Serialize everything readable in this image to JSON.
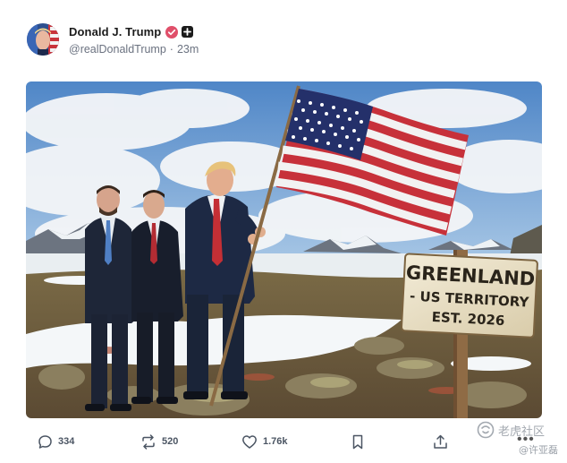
{
  "post": {
    "author_name": "Donald J. Trump",
    "handle": "@realDonaldTrump",
    "separator": "·",
    "time_ago": "23m"
  },
  "image": {
    "sign_line1": "GREENLAND",
    "sign_line2": "- US TERRITORY",
    "sign_line3": "EST. 2026"
  },
  "actions": {
    "replies": "334",
    "reposts": "520",
    "likes": "1.76k",
    "more": "•••"
  },
  "watermark": {
    "site": "老虎社区",
    "user": "@许亚磊"
  },
  "icons": {
    "reply": "reply-icon",
    "repost": "repost-icon",
    "like": "heart-icon",
    "bookmark": "bookmark-icon",
    "share": "share-icon",
    "verified": "verified-badge-icon",
    "plus": "plus-badge-icon"
  },
  "colors": {
    "verified_badge": "#e04f6a",
    "plus_badge": "#1b1b1b",
    "muted_text": "#6b7280"
  }
}
